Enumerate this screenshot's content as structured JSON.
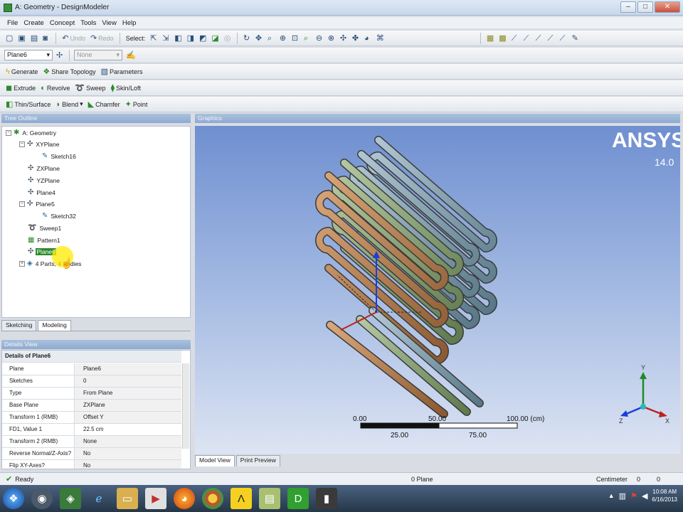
{
  "window": {
    "title": "A: Geometry - DesignModeler",
    "controls": [
      "–",
      "□",
      "✕"
    ]
  },
  "menu": [
    "File",
    "Create",
    "Concept",
    "Tools",
    "View",
    "Help"
  ],
  "toolbar1": {
    "undo": "Undo",
    "redo": "Redo",
    "select": "Select:"
  },
  "toolbar2": {
    "plane_value": "Plane6",
    "sketch_value": "None"
  },
  "toolbar3": {
    "generate": "Generate",
    "share_topology": "Share Topology",
    "parameters": "Parameters"
  },
  "toolbar4": {
    "extrude": "Extrude",
    "revolve": "Revolve",
    "sweep": "Sweep",
    "skin_loft": "Skin/Loft"
  },
  "toolbar5": {
    "thin_surface": "Thin/Surface",
    "blend": "Blend",
    "chamfer": "Chamfer",
    "point": "Point"
  },
  "tree_outline": {
    "header": "Tree Outline",
    "nodes": [
      {
        "label": "A: Geometry",
        "icon": "geometry-icon"
      },
      {
        "label": "XYPlane",
        "icon": "plane-icon"
      },
      {
        "label": "Sketch16",
        "icon": "sketch-icon"
      },
      {
        "label": "ZXPlane",
        "icon": "plane-icon"
      },
      {
        "label": "YZPlane",
        "icon": "plane-icon"
      },
      {
        "label": "Plane4",
        "icon": "plane-icon"
      },
      {
        "label": "Plane5",
        "icon": "plane-icon"
      },
      {
        "label": "Sketch32",
        "icon": "sketch-icon"
      },
      {
        "label": "Sweep1",
        "icon": "sweep-icon"
      },
      {
        "label": "Pattern1",
        "icon": "pattern-icon"
      },
      {
        "label": "Plane6",
        "icon": "plane-icon"
      },
      {
        "label": "4 Parts, 4 Bodies",
        "icon": "parts-icon"
      }
    ]
  },
  "mode_tabs": [
    "Sketching",
    "Modeling"
  ],
  "details": {
    "header": "Details View",
    "group": "Details of Plane6",
    "rows": [
      {
        "key": "Plane",
        "value": "Plane6"
      },
      {
        "key": "Sketches",
        "value": "0"
      },
      {
        "key": "Type",
        "value": "From Plane"
      },
      {
        "key": "Base Plane",
        "value": "ZXPlane"
      },
      {
        "key": "Transform 1 (RMB)",
        "value": "Offset Y"
      },
      {
        "key": "FD1, Value 1",
        "value": "22.5 cm"
      },
      {
        "key": "Transform 2 (RMB)",
        "value": "None"
      },
      {
        "key": "Reverse Normal/Z-Axis?",
        "value": "No"
      },
      {
        "key": "Flip XY-Axes?",
        "value": "No"
      }
    ]
  },
  "graphics": {
    "header": "Graphics",
    "logo": "ANSYS",
    "version": "14.0",
    "scale_top": [
      "0.00",
      "50.00",
      "100.00 (cm)"
    ],
    "scale_bottom": [
      "25.00",
      "75.00"
    ],
    "axis_labels": [
      "Y",
      "Z",
      "X"
    ],
    "tube_colors": {
      "copper": "#c08a5a",
      "green": "#8fa878",
      "blue": "#7f9fb0"
    }
  },
  "graphics_tabs": [
    "Model View",
    "Print Preview"
  ],
  "status": {
    "ready": "Ready",
    "selection": "0 Plane",
    "units": "Centimeter",
    "val1": "0",
    "val2": "0"
  },
  "taskbar": {
    "clock_time": "10:08 AM",
    "clock_date": "6/16/2013"
  }
}
